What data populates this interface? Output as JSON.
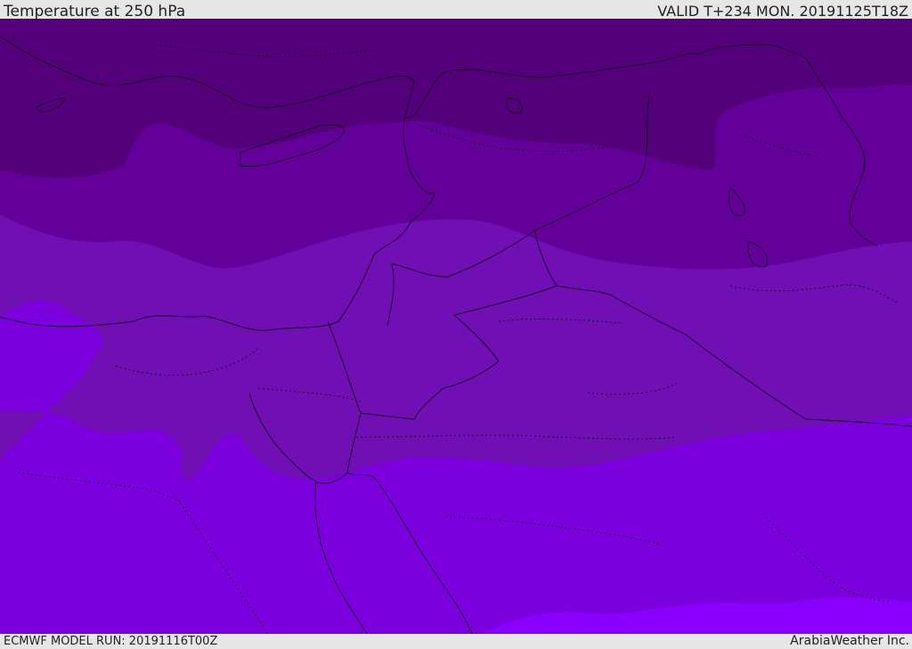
{
  "header": {
    "title": "Temperature at 250 hPa",
    "valid": "VALID T+234 MON. 20191125T18Z"
  },
  "footer": {
    "model_run": "ECMWF MODEL RUN: 20191116T00Z",
    "credit": "ArabiaWeather Inc."
  },
  "colors": {
    "band_coldest": "#54007a",
    "band_cold": "#64009a",
    "band_mid": "#7010b4",
    "band_warm": "#7c00de",
    "band_warmest": "#8a00ff",
    "border_line": "#1a0028"
  }
}
